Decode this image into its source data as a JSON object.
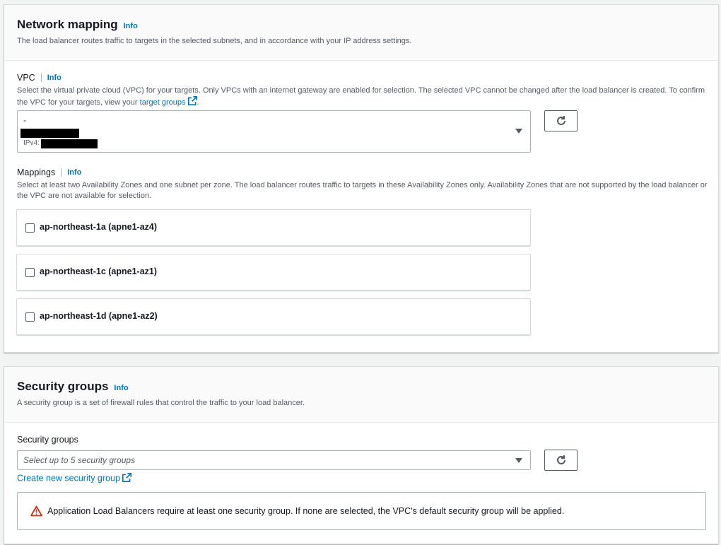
{
  "network_mapping": {
    "title": "Network mapping",
    "info": "Info",
    "description": "The load balancer routes traffic to targets in the selected subnets, and in accordance with your IP address settings.",
    "vpc": {
      "label": "VPC",
      "info": "Info",
      "description_part1": "Select the virtual private cloud (VPC) for your targets. Only VPCs with an internet gateway are enabled for selection. The selected VPC cannot be changed after the load balancer is created. To confirm the VPC for your targets, view your",
      "link_text": "target groups",
      "description_end": ".",
      "selected_name": "-",
      "ipv4_prefix": "IPv4:"
    },
    "mappings": {
      "label": "Mappings",
      "info": "Info",
      "description": "Select at least two Availability Zones and one subnet per zone. The load balancer routes traffic to targets in these Availability Zones only. Availability Zones that are not supported by the load balancer or the VPC are not available for selection.",
      "zones": [
        {
          "label": "ap-northeast-1a (apne1-az4)",
          "checked": false
        },
        {
          "label": "ap-northeast-1c (apne1-az1)",
          "checked": false
        },
        {
          "label": "ap-northeast-1d (apne1-az2)",
          "checked": false
        }
      ]
    }
  },
  "security_groups": {
    "title": "Security groups",
    "info": "Info",
    "description": "A security group is a set of firewall rules that control the traffic to your load balancer.",
    "field_label": "Security groups",
    "placeholder": "Select up to 5 security groups",
    "create_link": "Create new security group",
    "alert_text": "Application Load Balancers require at least one security group. If none are selected, the VPC's default security group will be applied."
  },
  "colors": {
    "link": "#0073bb",
    "warning": "#d13212",
    "text": "#16191f",
    "muted": "#545b64"
  }
}
